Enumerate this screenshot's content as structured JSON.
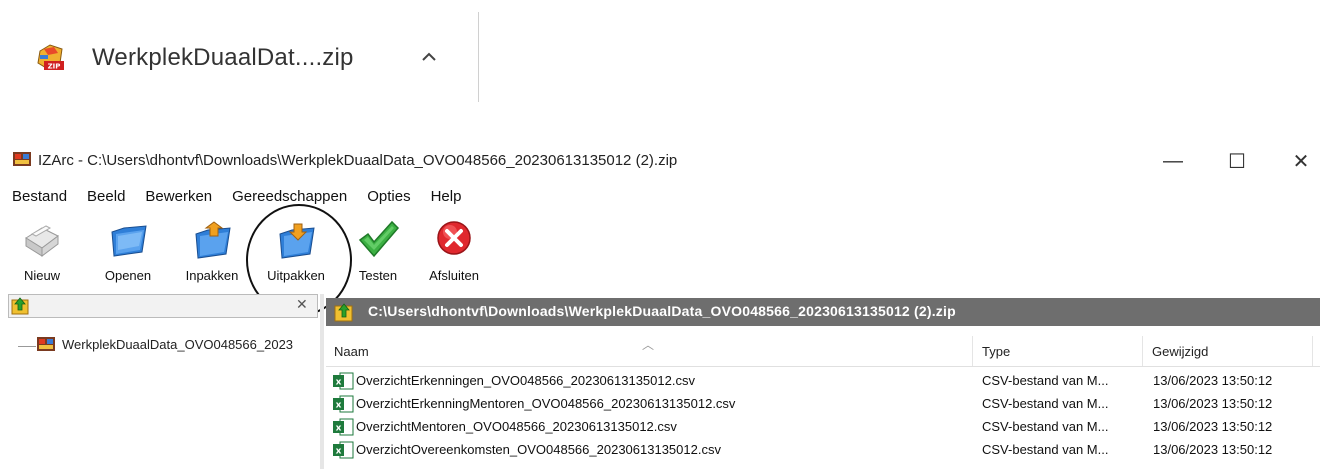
{
  "download_bar": {
    "file_name": "WerkplekDuaalDat....zip"
  },
  "window": {
    "title": "IZArc - C:\\Users\\dhontvf\\Downloads\\WerkplekDuaalData_OVO048566_20230613135012 (2).zip",
    "controls": {
      "minimize": "—",
      "maximize": "☐",
      "close": "✕"
    }
  },
  "menu": [
    "Bestand",
    "Beeld",
    "Bewerken",
    "Gereedschappen",
    "Opties",
    "Help"
  ],
  "toolbar": {
    "new": "Nieuw",
    "open": "Openen",
    "pack": "Inpakken",
    "unpack": "Uitpakken",
    "test": "Testen",
    "close": "Afsluiten"
  },
  "tree": {
    "root": "WerkplekDuaalData_OVO048566_2023"
  },
  "path_bar": {
    "path": "C:\\Users\\dhontvf\\Downloads\\WerkplekDuaalData_OVO048566_20230613135012 (2).zip"
  },
  "columns": {
    "name": "Naam",
    "type": "Type",
    "modified": "Gewijzigd"
  },
  "files": [
    {
      "name": "OverzichtErkenningen_OVO048566_20230613135012.csv",
      "type": "CSV-bestand van M...",
      "modified": "13/06/2023 13:50:12"
    },
    {
      "name": "OverzichtErkenningMentoren_OVO048566_20230613135012.csv",
      "type": "CSV-bestand van M...",
      "modified": "13/06/2023 13:50:12"
    },
    {
      "name": "OverzichtMentoren_OVO048566_20230613135012.csv",
      "type": "CSV-bestand van M...",
      "modified": "13/06/2023 13:50:12"
    },
    {
      "name": "OverzichtOvereenkomsten_OVO048566_20230613135012.csv",
      "type": "CSV-bestand van M...",
      "modified": "13/06/2023 13:50:12"
    }
  ],
  "colors": {
    "path_bar": "#6e6e6e",
    "excel_green": "#1e7a3c",
    "test_green": "#3cb043",
    "close_red": "#e0282e",
    "folder_blue": "#2f7fd8"
  }
}
